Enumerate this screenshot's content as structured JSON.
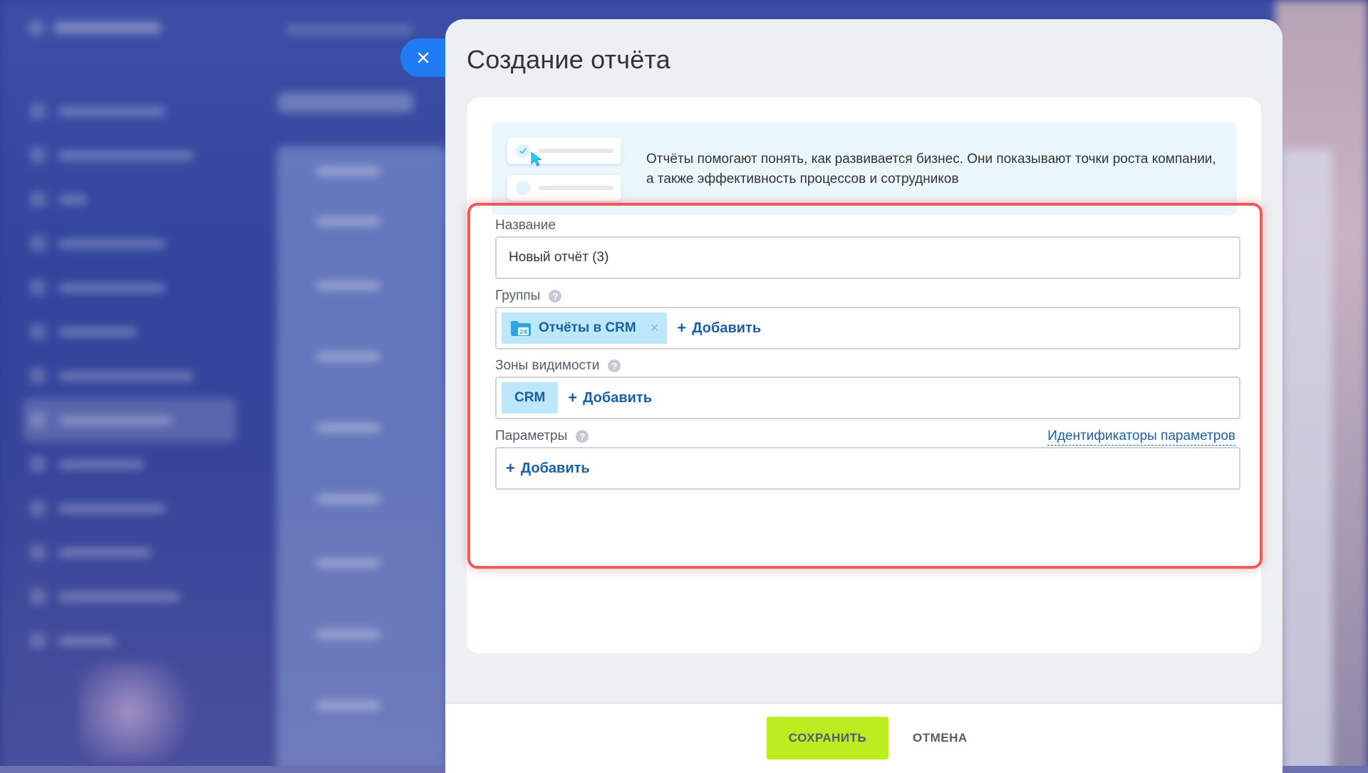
{
  "colors": {
    "accent_blue": "#1f7cf2",
    "link_blue": "#1a5ea8",
    "save_green": "#bbed21",
    "highlight_red": "#ef5a5f",
    "tag_bg": "#bde8fb",
    "banner_bg": "#eaf7fd"
  },
  "panel": {
    "title": "Создание отчёта",
    "close_icon": "close-icon"
  },
  "banner": {
    "text": "Отчёты помогают понять, как развивается бизнес. Они показывают точки роста компании, а также эффективность процессов и сотрудников",
    "illustration_icon": "report-checklist-illustration"
  },
  "form": {
    "name": {
      "label": "Название",
      "value": "Новый отчёт (3)"
    },
    "groups": {
      "label": "Группы",
      "help_icon": "question-icon",
      "tags": [
        {
          "label": "Отчёты в CRM",
          "icon": "folder-calendar-icon"
        }
      ],
      "add_label": "Добавить"
    },
    "visibility": {
      "label": "Зоны видимости",
      "help_icon": "question-icon",
      "tags": [
        {
          "label": "CRM"
        }
      ],
      "add_label": "Добавить"
    },
    "params": {
      "label": "Параметры",
      "help_icon": "question-icon",
      "ids_link": "Идентификаторы параметров",
      "add_label": "Добавить"
    }
  },
  "footer": {
    "save_label": "СОХРАНИТЬ",
    "cancel_label": "ОТМЕНА"
  }
}
